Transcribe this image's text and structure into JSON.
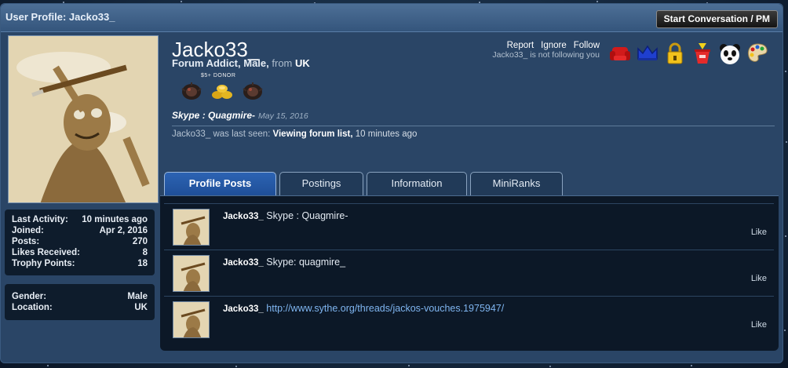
{
  "window": {
    "title": "User Profile: Jacko33_",
    "start_button": "Start Conversation / PM"
  },
  "profile": {
    "username": "Jacko33_",
    "user_title": "Forum Addict",
    "gender": "Male",
    "from_label": "from",
    "location": "UK",
    "donor_label": "$5+ DONOR",
    "status_text": "Skype : Quagmire-",
    "status_date": "May 15, 2016",
    "last_seen_prefix": "was last seen:",
    "last_seen_activity": "Viewing forum list",
    "last_seen_ago": "10 minutes ago"
  },
  "actions": {
    "report": "Report",
    "ignore": "Ignore",
    "follow": "Follow",
    "follow_status": "Jacko33_ is not following you"
  },
  "stats": [
    {
      "label": "Last Activity:",
      "value": "10 minutes ago"
    },
    {
      "label": "Joined:",
      "value": "Apr 2, 2016"
    },
    {
      "label": "Posts:",
      "value": "270"
    },
    {
      "label": "Likes Received:",
      "value": "8"
    },
    {
      "label": "Trophy Points:",
      "value": "18"
    }
  ],
  "personal": [
    {
      "label": "Gender:",
      "value": "Male"
    },
    {
      "label": "Location:",
      "value": "UK"
    }
  ],
  "tabs": [
    {
      "label": "Profile Posts",
      "active": true
    },
    {
      "label": "Postings",
      "active": false
    },
    {
      "label": "Information",
      "active": false
    },
    {
      "label": "MiniRanks",
      "active": false
    }
  ],
  "posts": [
    {
      "author": "Jacko33_",
      "text": "Skype : Quagmire-",
      "is_link": false,
      "like": "Like"
    },
    {
      "author": "Jacko33_",
      "text": "Skype: quagmire_",
      "is_link": false,
      "like": "Like"
    },
    {
      "author": "Jacko33_",
      "text": "http://www.sythe.org/threads/jackos-vouches.1975947/",
      "is_link": true,
      "like": "Like"
    }
  ],
  "trophy_icons": [
    "armchair-icon",
    "crown-icon",
    "padlock-icon",
    "bucket-icon",
    "panda-icon",
    "palette-icon"
  ],
  "badge_icons": [
    "dark-orb-icon",
    "gold-coins-icon",
    "dark-orb-icon"
  ],
  "colors": {
    "accent": "#2c63b3",
    "link": "#7fb5f0",
    "panel": "#2a4566"
  }
}
